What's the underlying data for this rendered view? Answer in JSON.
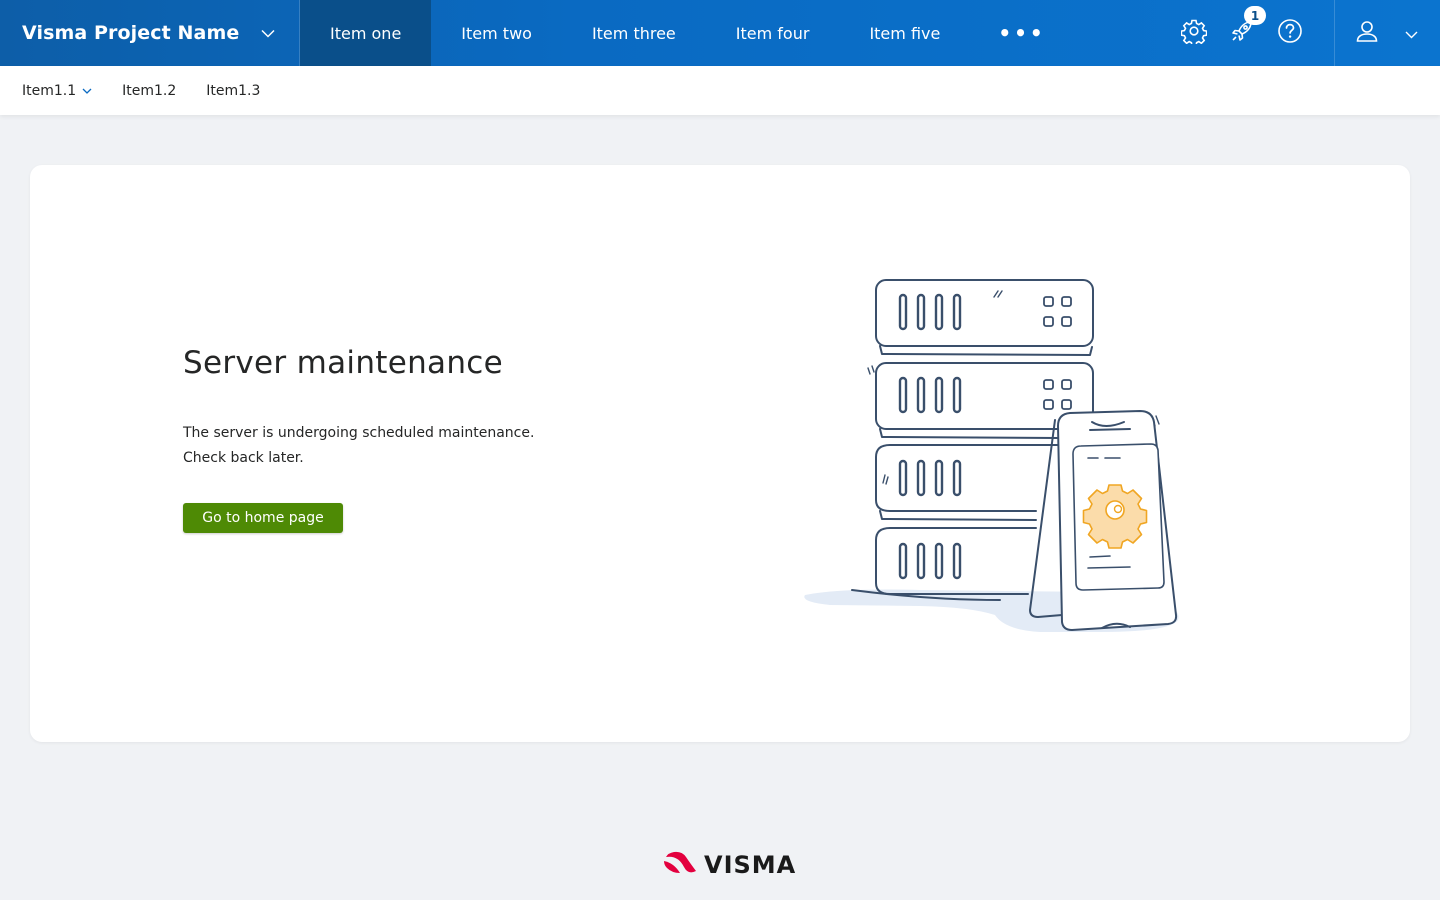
{
  "header": {
    "project_name": "Visma Project Name",
    "nav_items": [
      {
        "label": "Item one",
        "active": true
      },
      {
        "label": "Item two"
      },
      {
        "label": "Item three"
      },
      {
        "label": "Item four"
      },
      {
        "label": "Item five"
      }
    ],
    "more_label": "•••",
    "icons": [
      "gear-icon",
      "rocket-icon",
      "help-icon",
      "user-icon"
    ],
    "notification_count": "1"
  },
  "subnav": {
    "items": [
      {
        "label": "Item1.1",
        "has_dropdown": true
      },
      {
        "label": "Item1.2"
      },
      {
        "label": "Item1.3"
      }
    ]
  },
  "main": {
    "title": "Server maintenance",
    "line1": "The server is undergoing scheduled maintenance.",
    "line2": "Check back later.",
    "button_label": "Go to home page"
  },
  "footer": {
    "logo_text": "VISMA"
  },
  "colors": {
    "primary": "#0a6ac2",
    "active_nav": "#0a4f8a",
    "button_green": "#4e8a05",
    "logo_red": "#e3003e"
  }
}
